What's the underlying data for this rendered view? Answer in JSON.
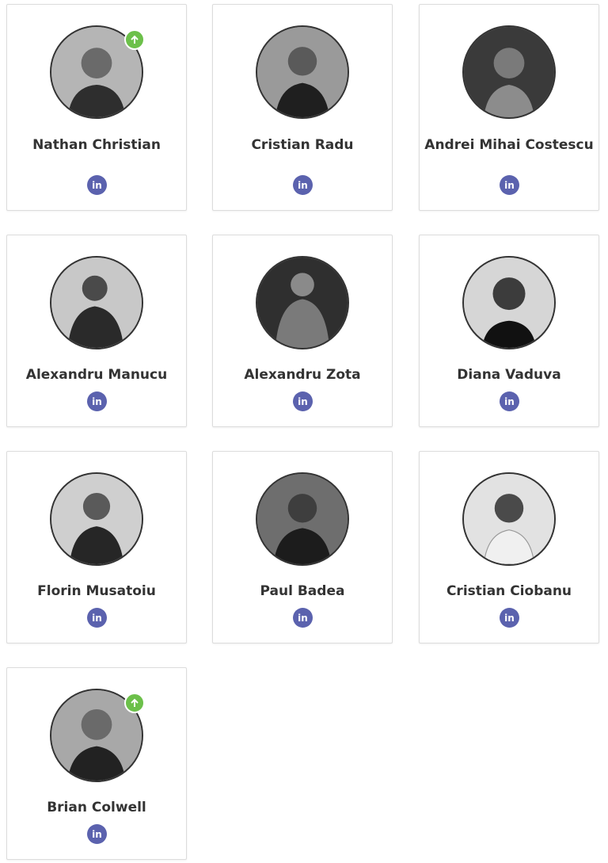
{
  "team": {
    "members": [
      {
        "name": "Nathan Christian",
        "badge": true,
        "linkedin_glyph": "in"
      },
      {
        "name": "Cristian Radu",
        "badge": false,
        "linkedin_glyph": "in"
      },
      {
        "name": "Andrei Mihai Costescu",
        "badge": false,
        "linkedin_glyph": "in"
      },
      {
        "name": "Alexandru Manucu",
        "badge": false,
        "linkedin_glyph": "in"
      },
      {
        "name": "Alexandru Zota",
        "badge": false,
        "linkedin_glyph": "in"
      },
      {
        "name": "Diana Vaduva",
        "badge": false,
        "linkedin_glyph": "in"
      },
      {
        "name": "Florin Musatoiu",
        "badge": false,
        "linkedin_glyph": "in"
      },
      {
        "name": "Paul Badea",
        "badge": false,
        "linkedin_glyph": "in"
      },
      {
        "name": "Cristian Ciobanu",
        "badge": false,
        "linkedin_glyph": "in"
      },
      {
        "name": "Brian Colwell",
        "badge": true,
        "linkedin_glyph": "in"
      }
    ]
  },
  "icons": {
    "badge": "arrow-up-icon",
    "social": "linkedin-icon"
  },
  "colors": {
    "badge": "#6cc04a",
    "linkedin": "#5b62ae",
    "name_text": "#333333",
    "border": "#dcdcdc"
  }
}
